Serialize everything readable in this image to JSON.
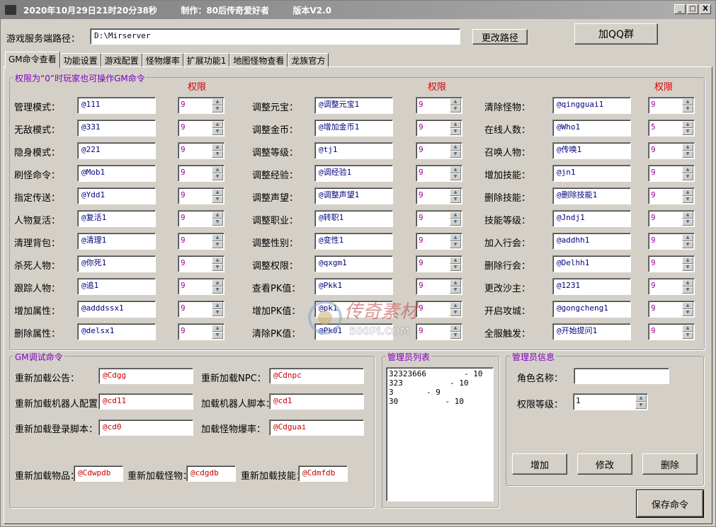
{
  "title": "2020年10月29日21时20分38秒        制作：80后传奇爱好者        版本V2.0",
  "window_buttons": [
    "_",
    "□",
    "X"
  ],
  "server_path": {
    "label": "游戏服务端路径：",
    "value": "D:\\Mirserver",
    "change_btn": "更改路径",
    "qq_btn": "加QQ群"
  },
  "tabs": [
    "GM命令查看",
    "功能设置",
    "游戏配置",
    "怪物爆率",
    "扩展功能1",
    "地图怪物查看",
    "龙族官方"
  ],
  "gm_group": {
    "title": "权限为“0”时玩家也可操作GM命令",
    "perm_header": "权限"
  },
  "col1": [
    {
      "label": "管理模式：",
      "cmd": "@111",
      "perm": "9"
    },
    {
      "label": "无敌模式：",
      "cmd": "@331",
      "perm": "9"
    },
    {
      "label": "隐身模式：",
      "cmd": "@221",
      "perm": "9"
    },
    {
      "label": "刷怪命令：",
      "cmd": "@Mob1",
      "perm": "9"
    },
    {
      "label": "指定传送：",
      "cmd": "@Ydd1",
      "perm": "9"
    },
    {
      "label": "人物复活：",
      "cmd": "@复活1",
      "perm": "9"
    },
    {
      "label": "清理背包：",
      "cmd": "@清理1",
      "perm": "9"
    },
    {
      "label": "杀死人物：",
      "cmd": "@你死1",
      "perm": "9"
    },
    {
      "label": "跟踪人物：",
      "cmd": "@追1",
      "perm": "9"
    },
    {
      "label": "增加属性：",
      "cmd": "@adddssx1",
      "perm": "9"
    },
    {
      "label": "删除属性：",
      "cmd": "@delsx1",
      "perm": "9"
    }
  ],
  "col2": [
    {
      "label": "调整元宝：",
      "cmd": "@调整元宝1",
      "perm": "9"
    },
    {
      "label": "调整金币：",
      "cmd": "@增加金币1",
      "perm": "9"
    },
    {
      "label": "调整等级：",
      "cmd": "@tj1",
      "perm": "9"
    },
    {
      "label": "调整经验：",
      "cmd": "@调经验1",
      "perm": "9"
    },
    {
      "label": "调整声望：",
      "cmd": "@调整声望1",
      "perm": "9"
    },
    {
      "label": "调整职业：",
      "cmd": "@转职1",
      "perm": "9"
    },
    {
      "label": "调整性别：",
      "cmd": "@变性1",
      "perm": "9"
    },
    {
      "label": "调整权限：",
      "cmd": "@qxgm1",
      "perm": "9"
    },
    {
      "label": "查看PK值：",
      "cmd": "@Pkk1",
      "perm": "9"
    },
    {
      "label": "增加PK值：",
      "cmd": "@pk1",
      "perm": "9"
    },
    {
      "label": "清除PK值：",
      "cmd": "@Pk01",
      "perm": "9"
    }
  ],
  "col3": [
    {
      "label": "清除怪物：",
      "cmd": "@qingguai1",
      "perm": "9"
    },
    {
      "label": "在线人数：",
      "cmd": "@Who1",
      "perm": "5"
    },
    {
      "label": "召唤人物：",
      "cmd": "@传唤1",
      "perm": "9"
    },
    {
      "label": "增加技能：",
      "cmd": "@jn1",
      "perm": "9"
    },
    {
      "label": "删除技能：",
      "cmd": "@删除技能1",
      "perm": "9"
    },
    {
      "label": "技能等级：",
      "cmd": "@Jndj1",
      "perm": "9"
    },
    {
      "label": "加入行会：",
      "cmd": "@addhh1",
      "perm": "9"
    },
    {
      "label": "删除行会：",
      "cmd": "@Delhh1",
      "perm": "9"
    },
    {
      "label": "更改沙主：",
      "cmd": "@1231",
      "perm": "9"
    },
    {
      "label": "开启攻城：",
      "cmd": "@gongcheng1",
      "perm": "9"
    },
    {
      "label": "全服触发：",
      "cmd": "@开始提问1",
      "perm": "9"
    }
  ],
  "debug": {
    "title": "GM调试命令",
    "reload_notice": {
      "label": "重新加载公告：",
      "value": "@Cdgg"
    },
    "reload_npc": {
      "label": "重新加载NPC：",
      "value": "@Cdnpc"
    },
    "reload_robot_cfg": {
      "label": "重新加载机器人配置：",
      "value": "@cd11"
    },
    "load_robot_script": {
      "label": "加载机器人脚本：",
      "value": "@cd1"
    },
    "reload_login_script": {
      "label": "重新加载登录脚本：",
      "value": "@cd0"
    },
    "load_monster_drop": {
      "label": "加载怪物爆率：",
      "value": "@Cdguai"
    },
    "reload_items": {
      "label": "重新加载物品：",
      "value": "@Cdwpdb"
    },
    "reload_monsters": {
      "label": "重新加载怪物：",
      "value": "@cdgdb"
    },
    "reload_skills": {
      "label": "重新加载技能：",
      "value": "@Cdmfdb"
    }
  },
  "admin_list": {
    "title": "管理员列表",
    "items": [
      "32323666        - 10",
      "323          - 10",
      "3       - 9",
      "30          - 10"
    ]
  },
  "admin_info": {
    "title": "管理员信息",
    "role_label": "角色名称：",
    "role_value": "",
    "level_label": "权限等级：",
    "level_value": "1",
    "add_btn": "增加",
    "edit_btn": "修改",
    "del_btn": "删除"
  },
  "save_btn": "保存命令",
  "watermark": {
    "text": "传奇素材",
    "sub": "500Pi.COM"
  }
}
